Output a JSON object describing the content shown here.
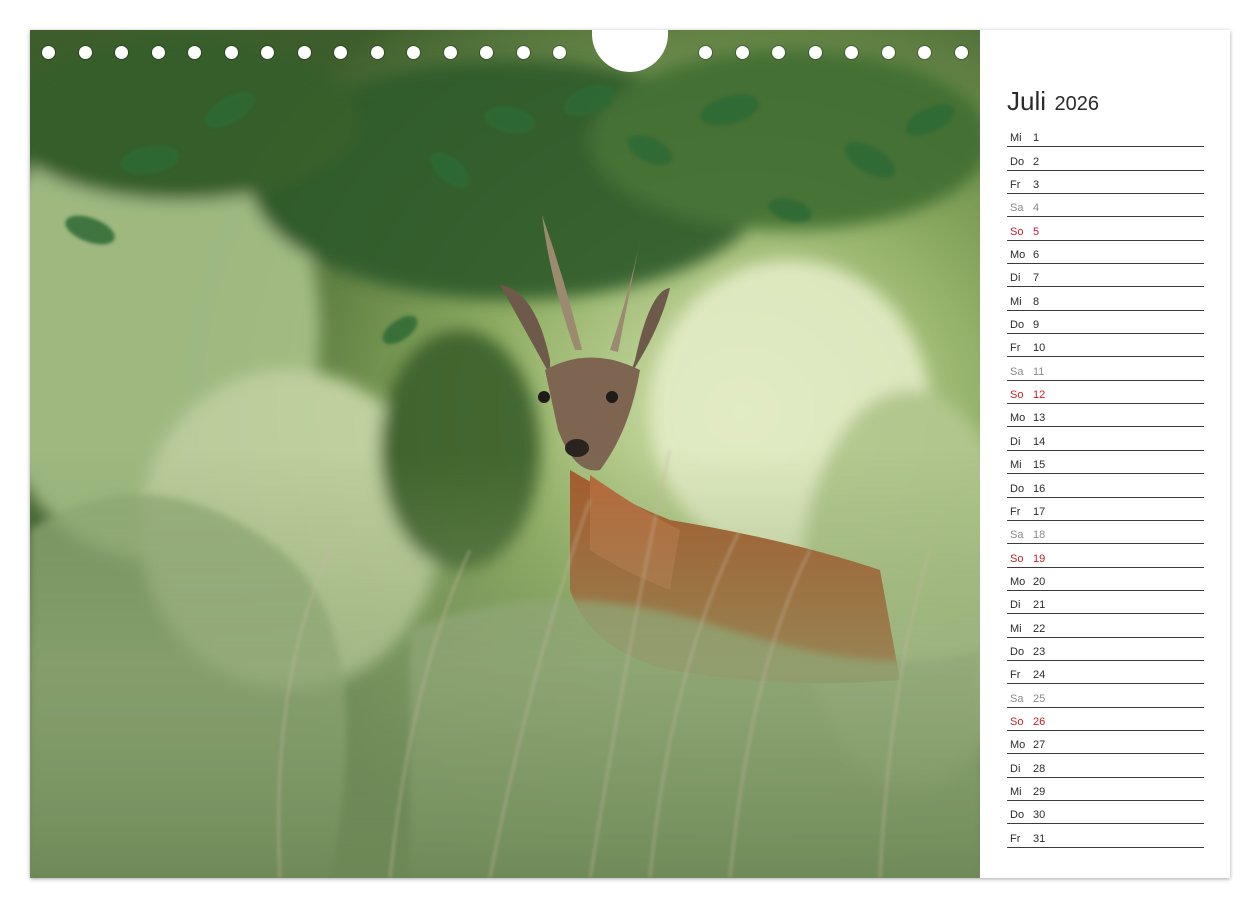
{
  "calendar": {
    "month": "Juli",
    "year": "2026",
    "days": [
      {
        "wd": "Mi",
        "d": "1",
        "type": "weekday"
      },
      {
        "wd": "Do",
        "d": "2",
        "type": "weekday"
      },
      {
        "wd": "Fr",
        "d": "3",
        "type": "weekday"
      },
      {
        "wd": "Sa",
        "d": "4",
        "type": "saturday"
      },
      {
        "wd": "So",
        "d": "5",
        "type": "sunday"
      },
      {
        "wd": "Mo",
        "d": "6",
        "type": "weekday"
      },
      {
        "wd": "Di",
        "d": "7",
        "type": "weekday"
      },
      {
        "wd": "Mi",
        "d": "8",
        "type": "weekday"
      },
      {
        "wd": "Do",
        "d": "9",
        "type": "weekday"
      },
      {
        "wd": "Fr",
        "d": "10",
        "type": "weekday"
      },
      {
        "wd": "Sa",
        "d": "11",
        "type": "saturday"
      },
      {
        "wd": "So",
        "d": "12",
        "type": "sunday"
      },
      {
        "wd": "Mo",
        "d": "13",
        "type": "weekday"
      },
      {
        "wd": "Di",
        "d": "14",
        "type": "weekday"
      },
      {
        "wd": "Mi",
        "d": "15",
        "type": "weekday"
      },
      {
        "wd": "Do",
        "d": "16",
        "type": "weekday"
      },
      {
        "wd": "Fr",
        "d": "17",
        "type": "weekday"
      },
      {
        "wd": "Sa",
        "d": "18",
        "type": "saturday"
      },
      {
        "wd": "So",
        "d": "19",
        "type": "sunday"
      },
      {
        "wd": "Mo",
        "d": "20",
        "type": "weekday"
      },
      {
        "wd": "Di",
        "d": "21",
        "type": "weekday"
      },
      {
        "wd": "Mi",
        "d": "22",
        "type": "weekday"
      },
      {
        "wd": "Do",
        "d": "23",
        "type": "weekday"
      },
      {
        "wd": "Fr",
        "d": "24",
        "type": "weekday"
      },
      {
        "wd": "Sa",
        "d": "25",
        "type": "saturday"
      },
      {
        "wd": "So",
        "d": "26",
        "type": "sunday"
      },
      {
        "wd": "Mo",
        "d": "27",
        "type": "weekday"
      },
      {
        "wd": "Di",
        "d": "28",
        "type": "weekday"
      },
      {
        "wd": "Mi",
        "d": "29",
        "type": "weekday"
      },
      {
        "wd": "Do",
        "d": "30",
        "type": "weekday"
      },
      {
        "wd": "Fr",
        "d": "31",
        "type": "weekday"
      }
    ]
  },
  "colors": {
    "sunday": "#c0222b",
    "saturday": "#8a8a8a",
    "text": "#2b2b2b",
    "foliage": "#4f7a3a"
  },
  "photo": {
    "subject": "roe-deer-in-foliage"
  }
}
